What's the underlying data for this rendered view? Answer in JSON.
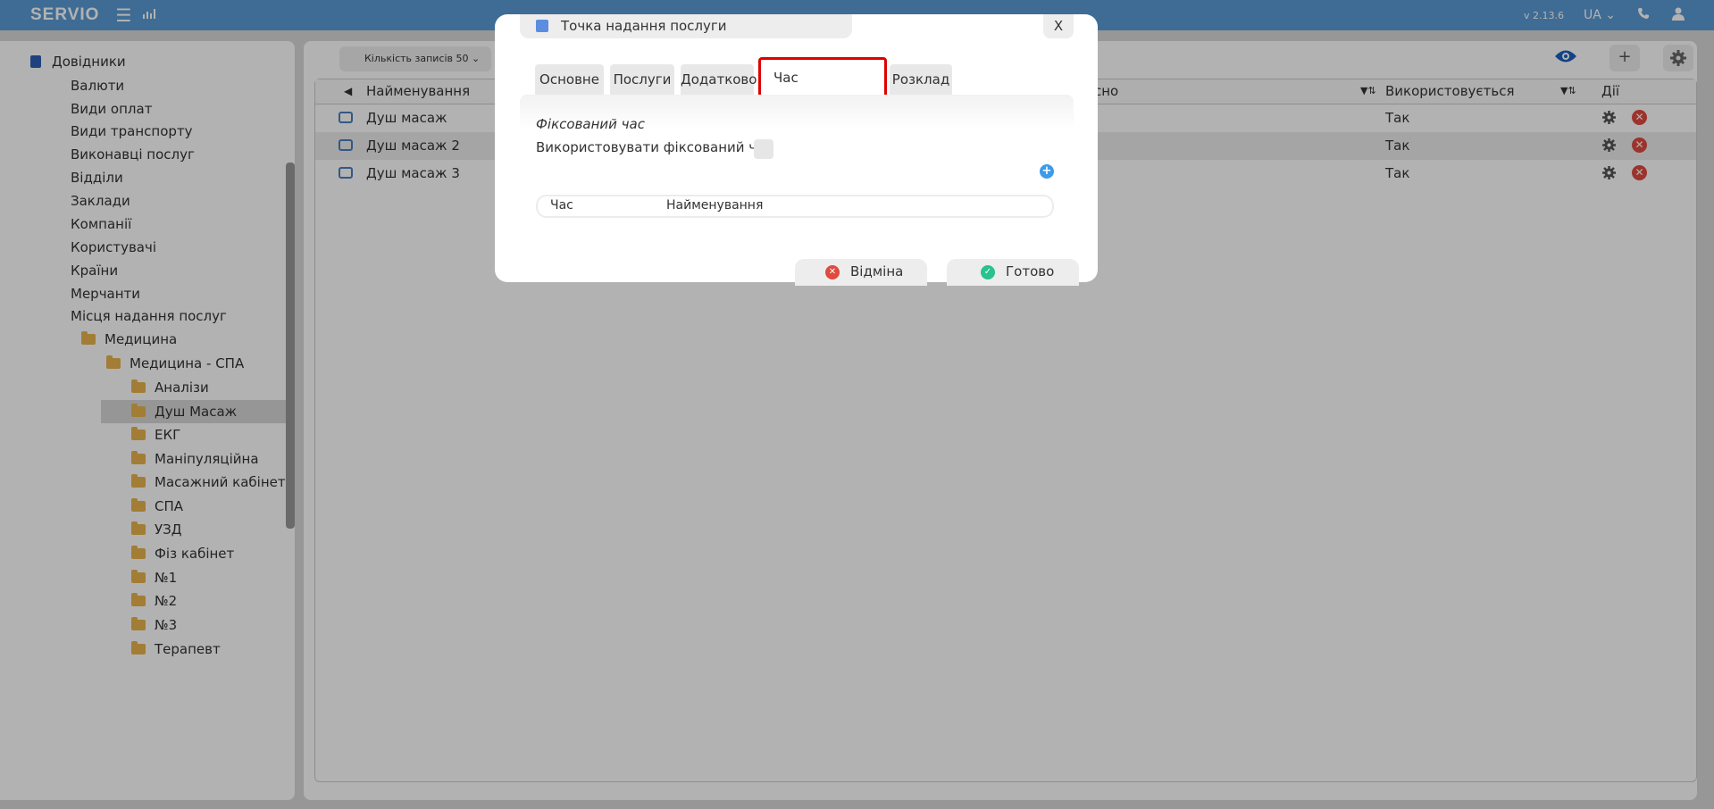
{
  "topbar": {
    "logo": "SERVIO",
    "version": "v 2.13.6",
    "lang": "UA"
  },
  "sidebar": {
    "root": "Довідники",
    "items": [
      "Валюти",
      "Види оплат",
      "Види транспорту",
      "Виконавці послуг",
      "Відділи",
      "Заклади",
      "Компанії",
      "Користувачі",
      "Країни",
      "Мерчанти",
      "Місця надання послуг"
    ],
    "folder_l1": "Медицина",
    "folder_l2": "Медицина - СПА",
    "folders_l3": [
      "Аналізи",
      "Душ Масаж",
      "ЕКГ",
      "Маніпуляційна",
      "Масажний кабінет",
      "СПА",
      "УЗД",
      "Фіз кабінет",
      "№1",
      "№2",
      "№3",
      "Терапевт"
    ]
  },
  "main": {
    "records_label": "Кількість записів",
    "records_value": "50",
    "plus": "+",
    "columns": {
      "name": "Найменування",
      "partial": "сно",
      "used": "Використовується",
      "actions": "Дії"
    },
    "rows": [
      {
        "name": "Душ масаж",
        "used": "Так"
      },
      {
        "name": "Душ масаж 2",
        "used": "Так"
      },
      {
        "name": "Душ масаж 3",
        "used": "Так"
      }
    ]
  },
  "modal": {
    "title": "Точка надання послуги",
    "close": "X",
    "tabs": [
      "Основне",
      "Послуги",
      "Додатково",
      "Час",
      "Розклад"
    ],
    "section_title": "Фіксований час",
    "checkbox_label": "Використовувати фіксований час",
    "checkbox_checked": false,
    "sub_columns": [
      "Час",
      "Найменування"
    ],
    "cancel": "Відміна",
    "ok": "Готово"
  },
  "colors": {
    "topbar": "#5b9bd5",
    "active_tab_border": "#e00000",
    "add": "#3d9be9",
    "cancel_icon": "#e04a3f",
    "ok_icon": "#28c28c",
    "folder": "#e8b44d"
  }
}
